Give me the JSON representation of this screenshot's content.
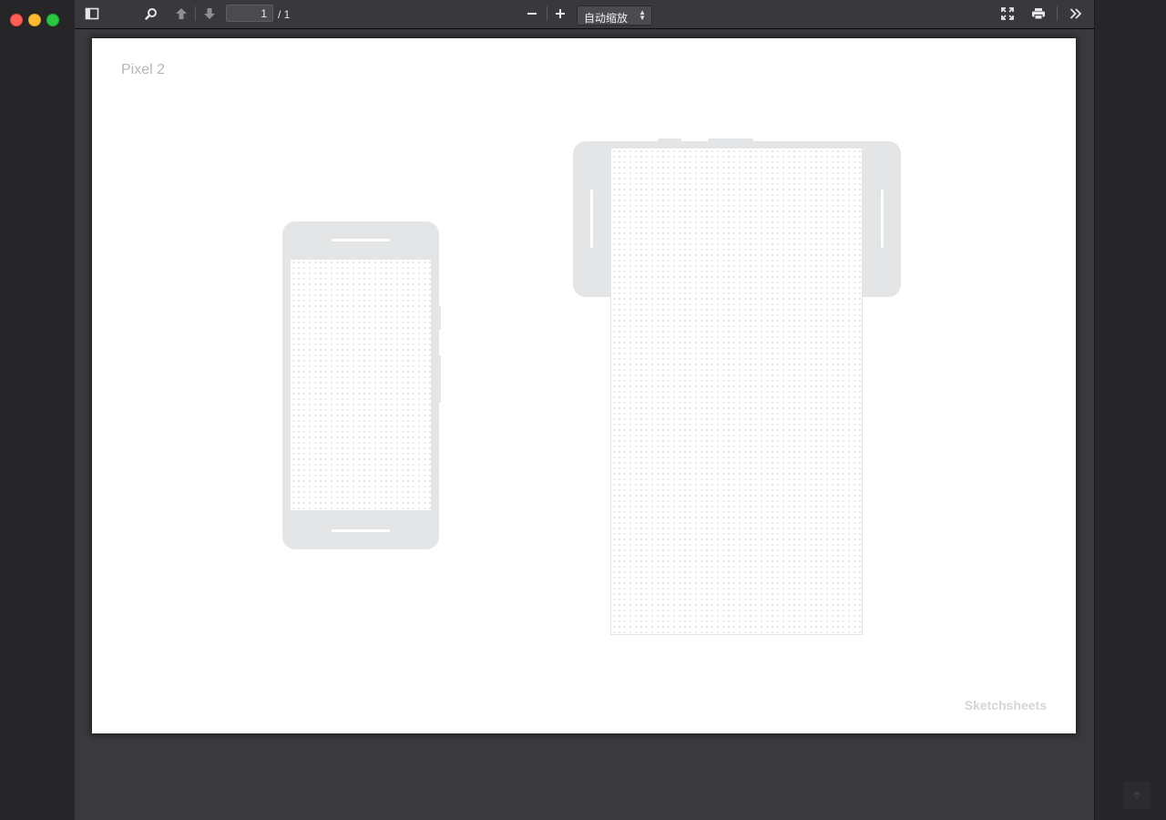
{
  "window": {
    "controls": [
      "close",
      "minimize",
      "zoom"
    ]
  },
  "toolbar": {
    "icons": {
      "sidebar_toggle": "sidebar-toggle-icon",
      "find": "search-icon",
      "prev_page": "arrow-up-icon",
      "next_page": "arrow-down-icon",
      "zoom_out": "minus-icon",
      "zoom_in": "plus-icon",
      "presentation": "fullscreen-icon",
      "print": "printer-icon",
      "tools": "double-chevron-right-icon"
    },
    "page_number": "1",
    "page_count": "/ 1",
    "zoom_selected": "自动缩放"
  },
  "document": {
    "title": "Pixel 2",
    "brand": "Sketchsheets"
  },
  "colors": {
    "chrome_dark": "#262628",
    "toolbar": "#38383d",
    "viewer_bg": "#3a3a3c",
    "page": "#ffffff",
    "device_gray": "#e3e5e7",
    "title_gray": "#b4b6b9"
  },
  "scroll_top_icon": "arrow-up-icon"
}
